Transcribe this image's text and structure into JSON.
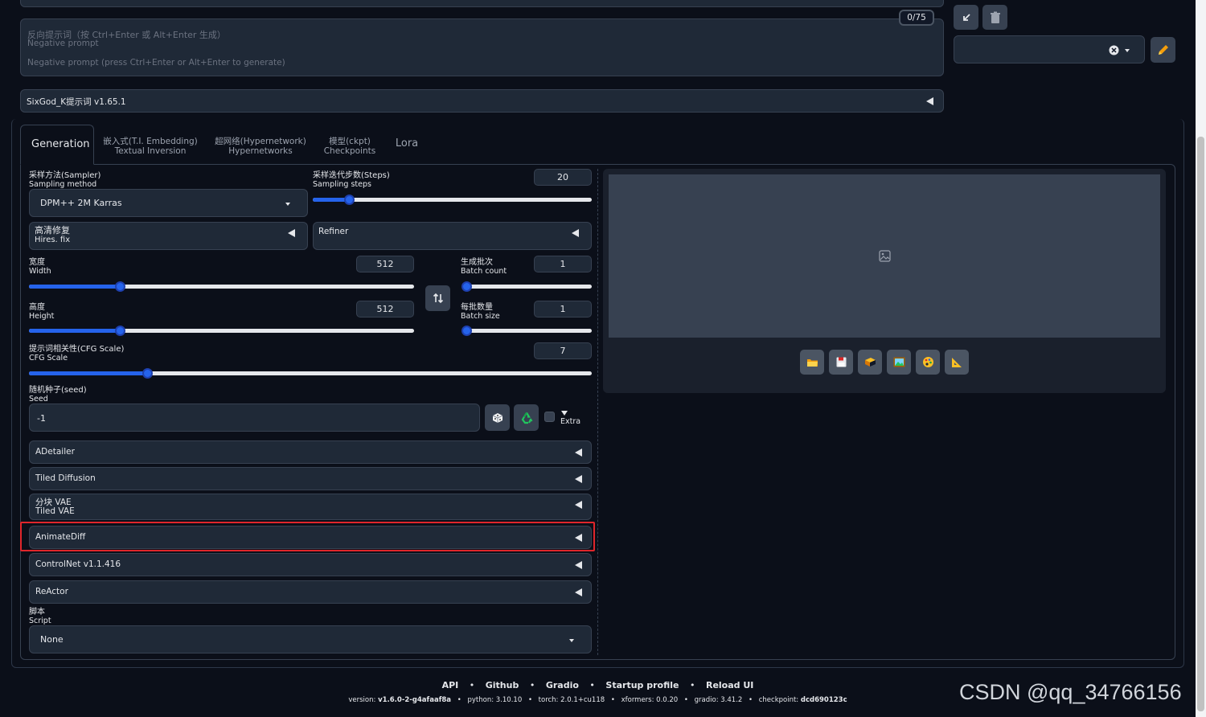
{
  "prompt": {
    "token_count": "0/75",
    "negative_placeholder_cn": "反向提示词（按 Ctrl+Enter 或 Alt+Enter 生成）",
    "negative_placeholder_en1": "Negative prompt",
    "negative_placeholder_en2": "Negative prompt (press Ctrl+Enter or Alt+Enter to generate)"
  },
  "extension_bar": "SixGod_K提示词 v1.65.1",
  "tabs": [
    {
      "label": "Generation",
      "sub": ""
    },
    {
      "label": "嵌入式(T.I. Embedding)",
      "sub": "Textual Inversion"
    },
    {
      "label": "超网络(Hypernetwork)",
      "sub": "Hypernetworks"
    },
    {
      "label": "模型(ckpt)",
      "sub": "Checkpoints"
    },
    {
      "label": "Lora",
      "sub": ""
    }
  ],
  "sampler": {
    "label_cn": "采样方法(Sampler)",
    "label_en": "Sampling method",
    "value": "DPM++ 2M Karras"
  },
  "steps": {
    "label_cn": "采样迭代步数(Steps)",
    "label_en": "Sampling steps",
    "value": "20",
    "fraction": 0.13
  },
  "hires": {
    "label_cn": "高清修复",
    "label_en": "Hires. fix"
  },
  "refiner": {
    "label": "Refiner"
  },
  "width": {
    "label_cn": "宽度",
    "label_en": "Width",
    "value": "512",
    "fraction": 0.235
  },
  "height": {
    "label_cn": "高度",
    "label_en": "Height",
    "value": "512",
    "fraction": 0.235
  },
  "batch_count": {
    "label_cn": "生成批次",
    "label_en": "Batch count",
    "value": "1",
    "fraction": 0.0
  },
  "batch_size": {
    "label_cn": "每批数量",
    "label_en": "Batch size",
    "value": "1",
    "fraction": 0.0
  },
  "cfg": {
    "label_cn": "提示词相关性(CFG Scale)",
    "label_en": "CFG Scale",
    "value": "7",
    "fraction": 0.21
  },
  "seed": {
    "label_cn": "随机种子(seed)",
    "label_en": "Seed",
    "value": "-1",
    "extra_label": "Extra"
  },
  "accordions": [
    {
      "label": "ADetailer",
      "sub": ""
    },
    {
      "label": "Tiled Diffusion",
      "sub": ""
    },
    {
      "label": "分块 VAE",
      "sub": "Tiled VAE"
    },
    {
      "label": "AnimateDiff",
      "sub": ""
    },
    {
      "label": "ControlNet v1.1.416",
      "sub": ""
    },
    {
      "label": "ReActor",
      "sub": ""
    }
  ],
  "script": {
    "label_cn": "脚本",
    "label_en": "Script",
    "value": "None"
  },
  "footer": {
    "links": [
      "API",
      "Github",
      "Gradio",
      "Startup profile",
      "Reload UI"
    ],
    "version_label": "version:",
    "version": "v1.6.0-2-g4afaaf8a",
    "python_label": "python:",
    "python": "3.10.10",
    "torch_label": "torch:",
    "torch": "2.0.1+cu118",
    "xformers_label": "xformers:",
    "xformers": "0.0.20",
    "gradio_label": "gradio:",
    "gradio": "3.41.2",
    "checkpoint_label": "checkpoint:",
    "checkpoint": "dcd690123c"
  },
  "watermark": "CSDN @qq_34766156",
  "colors": {
    "accent": "#2563eb",
    "highlight": "#e0262b",
    "background": "#0b0f19"
  }
}
